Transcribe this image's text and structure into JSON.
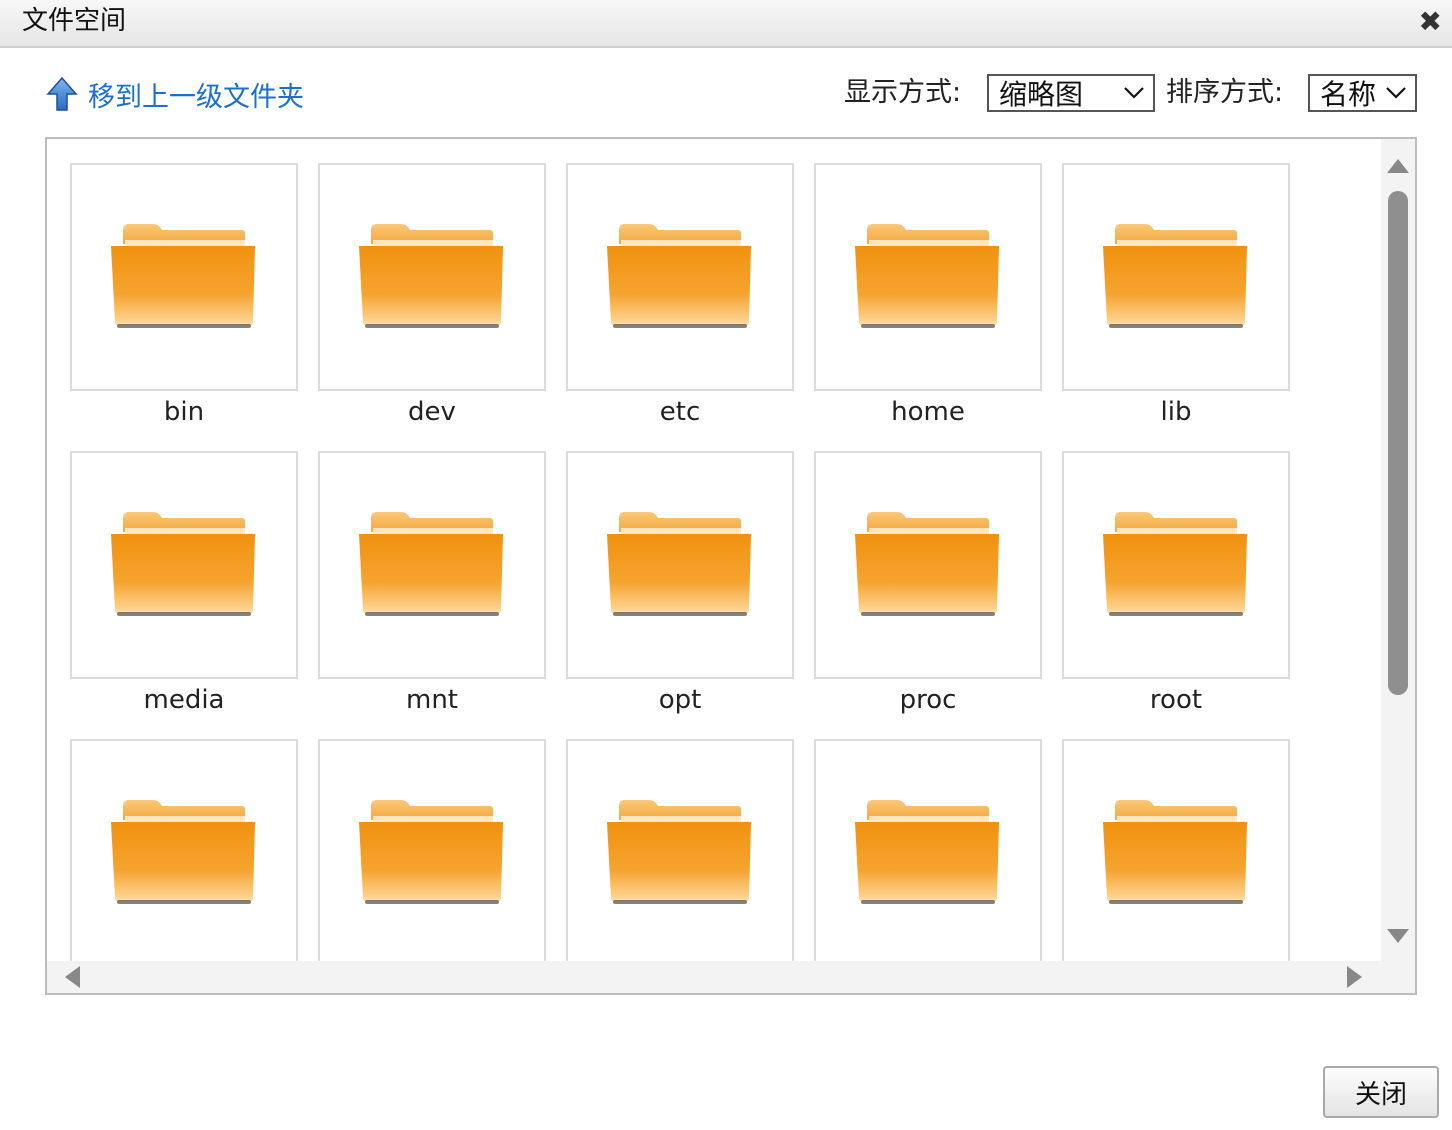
{
  "dialog": {
    "title": "文件空间",
    "close_icon": "✕"
  },
  "toolbar": {
    "up_label": "移到上一级文件夹",
    "view_label": "显示方式:",
    "view_value": "缩略图",
    "sort_label": "排序方式:",
    "sort_value": "名称"
  },
  "folders": [
    "bin",
    "dev",
    "etc",
    "home",
    "lib",
    "media",
    "mnt",
    "opt",
    "proc",
    "root",
    "",
    "",
    "",
    "",
    ""
  ],
  "footer": {
    "close_label": "关闭"
  },
  "colors": {
    "link": "#1a6fd0",
    "folder": "#f39a1e",
    "folder_tab": "#f7b860"
  }
}
